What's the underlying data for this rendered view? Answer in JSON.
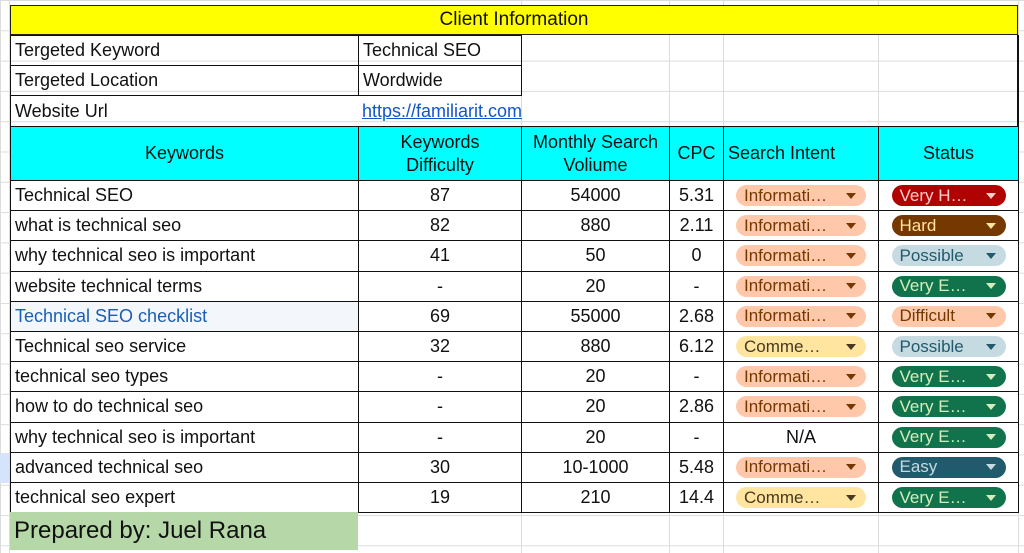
{
  "title": "Client Information",
  "client_info": [
    {
      "label": "Tergeted Keyword",
      "value": "Technical SEO"
    },
    {
      "label": "Tergeted Location",
      "value": "Wordwide"
    },
    {
      "label": "Website Url",
      "value": "https://familiarit.com"
    }
  ],
  "headers": {
    "keywords": "Keywords",
    "difficulty_line1": "Keywords",
    "difficulty_line2": "Difficulty",
    "volume_line1": "Monthly Search",
    "volume_line2": "Voliume",
    "cpc": "CPC",
    "intent": "Search Intent",
    "status": "Status"
  },
  "rows": [
    {
      "keyword": "Technical SEO",
      "difficulty": "87",
      "volume": "54000",
      "cpc": "5.31",
      "intent": "Informati…",
      "status": "Very H…"
    },
    {
      "keyword": "what is technical seo",
      "difficulty": "82",
      "volume": "880",
      "cpc": "2.11",
      "intent": "Informati…",
      "status": "Hard"
    },
    {
      "keyword": "why technical seo is important",
      "difficulty": "41",
      "volume": "50",
      "cpc": "0",
      "intent": "Informati…",
      "status": "Possible"
    },
    {
      "keyword": "website technical terms",
      "difficulty": "-",
      "volume": "20",
      "cpc": "-",
      "intent": "Informati…",
      "status": "Very E…"
    },
    {
      "keyword": "Technical SEO checklist",
      "difficulty": "69",
      "volume": "55000",
      "cpc": "2.68",
      "intent": "Informati…",
      "status": "Difficult"
    },
    {
      "keyword": "Technical seo service",
      "difficulty": "32",
      "volume": "880",
      "cpc": "6.12",
      "intent": "Comme…",
      "status": "Possible"
    },
    {
      "keyword": "technical seo types",
      "difficulty": "-",
      "volume": "20",
      "cpc": "-",
      "intent": "Informati…",
      "status": "Very E…"
    },
    {
      "keyword": "how to do technical seo",
      "difficulty": "-",
      "volume": "20",
      "cpc": "2.86",
      "intent": "Informati…",
      "status": "Very E…"
    },
    {
      "keyword": "why technical seo is important",
      "difficulty": "-",
      "volume": "20",
      "cpc": "-",
      "intent": "N/A",
      "status": "Very E…"
    },
    {
      "keyword": "advanced technical seo",
      "difficulty": "30",
      "volume": "10-1000",
      "cpc": "5.48",
      "intent": "Informati…",
      "status": "Easy"
    },
    {
      "keyword": "technical seo expert",
      "difficulty": "19",
      "volume": "210",
      "cpc": "14.4",
      "intent": "Comme…",
      "status": "Very E…"
    }
  ],
  "footer": "Prepared by: Juel Rana",
  "colors": {
    "title_bg": "#ffff00",
    "header_bg": "#00ffff",
    "footer_bg": "#b6d7a8",
    "link": "#1155cc",
    "intent_informational": {
      "bg": "#ffc8aa",
      "fg": "#753800"
    },
    "intent_commercial": {
      "bg": "#ffe5a0",
      "fg": "#473821"
    },
    "status_very_hard": {
      "bg": "#b10202",
      "fg": "#ffcfc9"
    },
    "status_hard": {
      "bg": "#753800",
      "fg": "#ffe5a0"
    },
    "status_possible": {
      "bg": "#c6dbe1",
      "fg": "#215a6c"
    },
    "status_very_easy": {
      "bg": "#11734b",
      "fg": "#d4edbc"
    },
    "status_difficult": {
      "bg": "#ffc8aa",
      "fg": "#753800"
    },
    "status_easy": {
      "bg": "#215a6c",
      "fg": "#c6dbe1"
    }
  }
}
